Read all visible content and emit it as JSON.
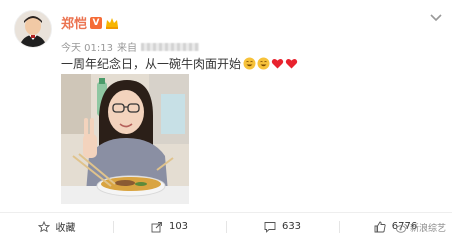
{
  "post": {
    "author": "郑恺",
    "vip_badge": "V",
    "time": "今天 01:13",
    "source_prefix": "来自",
    "text": "一周年纪念日，从一碗牛肉面开始"
  },
  "actions": {
    "favorite": "收藏",
    "share": "103",
    "comment": "633",
    "like": "6776"
  },
  "watermark": "新浪综艺",
  "colors": {
    "author": "#eb7350",
    "heart": "#e8222e",
    "emoji": "#f7c23a"
  }
}
